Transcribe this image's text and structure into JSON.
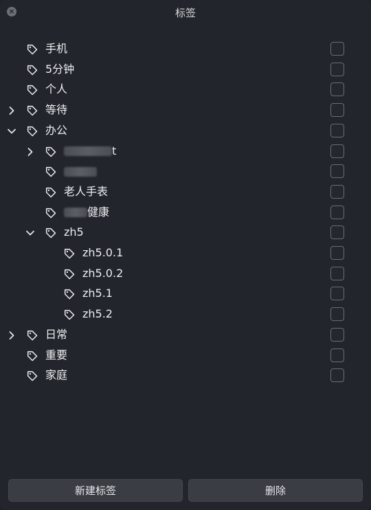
{
  "window": {
    "title": "标签"
  },
  "tags": [
    {
      "label": "手机",
      "level": 0,
      "chevron": "none",
      "checked": false
    },
    {
      "label": "5分钟",
      "level": 0,
      "chevron": "none",
      "checked": false
    },
    {
      "label": "个人",
      "level": 0,
      "chevron": "none",
      "checked": false
    },
    {
      "label": "等待",
      "level": 0,
      "chevron": "collapsed",
      "checked": false
    },
    {
      "label": "办公",
      "level": 0,
      "chevron": "expanded",
      "checked": false
    },
    {
      "label": "t",
      "level": 1,
      "chevron": "collapsed",
      "checked": false,
      "redacted_prefix": true
    },
    {
      "label": "",
      "level": 1,
      "chevron": "none",
      "checked": false,
      "redacted_prefix": true
    },
    {
      "label": "老人手表",
      "level": 1,
      "chevron": "none",
      "checked": false
    },
    {
      "label": "健康",
      "level": 1,
      "chevron": "none",
      "checked": false,
      "redacted_prefix": true
    },
    {
      "label": "zh5",
      "level": 1,
      "chevron": "expanded",
      "checked": false
    },
    {
      "label": "zh5.0.1",
      "level": 2,
      "chevron": "none",
      "checked": false
    },
    {
      "label": "zh5.0.2",
      "level": 2,
      "chevron": "none",
      "checked": false
    },
    {
      "label": "zh5.1",
      "level": 2,
      "chevron": "none",
      "checked": false
    },
    {
      "label": "zh5.2",
      "level": 2,
      "chevron": "none",
      "checked": false
    },
    {
      "label": "日常",
      "level": 0,
      "chevron": "collapsed",
      "checked": false
    },
    {
      "label": "重要",
      "level": 0,
      "chevron": "none",
      "checked": false
    },
    {
      "label": "家庭",
      "level": 0,
      "chevron": "none",
      "checked": false
    }
  ],
  "footer": {
    "new_label": "新建标签",
    "delete_label": "删除"
  },
  "icons": {
    "close": "close-icon",
    "tag": "tag-icon",
    "chevron_right": "chevron-right-icon",
    "chevron_down": "chevron-down-icon"
  },
  "colors": {
    "background": "#22252b",
    "text": "#eceef1",
    "button": "#3a3d43",
    "checkbox_border": "#6a6d73"
  }
}
